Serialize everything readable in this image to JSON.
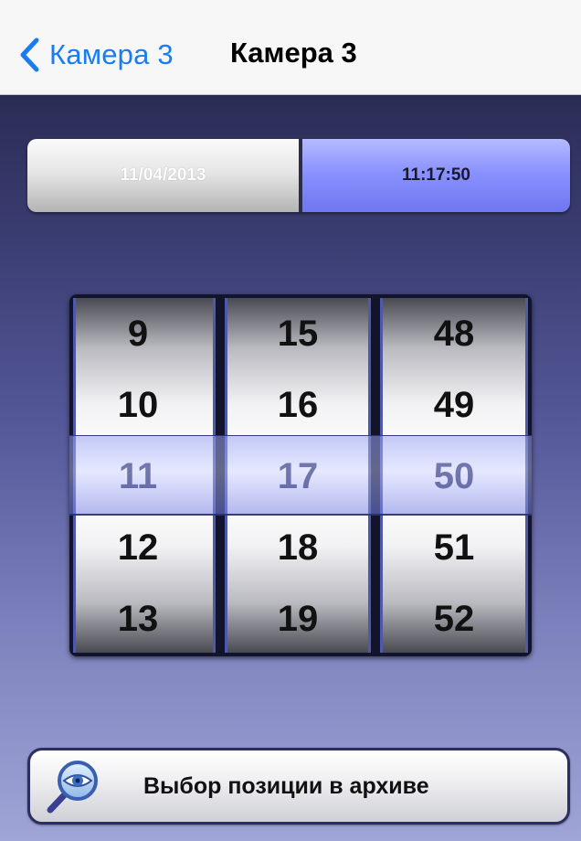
{
  "navbar": {
    "back_label": "Камера 3",
    "title": "Камера 3",
    "back_icon": "chevron-left-icon"
  },
  "segmented": {
    "date_label": "11/04/2013",
    "time_label": "11:17:50",
    "selected": "time"
  },
  "picker": {
    "hours": [
      "9",
      "10",
      "11",
      "12",
      "13"
    ],
    "minutes": [
      "15",
      "16",
      "17",
      "18",
      "19"
    ],
    "seconds": [
      "48",
      "49",
      "50",
      "51",
      "52"
    ],
    "selected": {
      "hour": "11",
      "minute": "17",
      "second": "50"
    }
  },
  "archive_button": {
    "label": "Выбор позиции в архиве",
    "icon": "magnifier-eye-icon"
  },
  "colors": {
    "accent": "#1a7cf0",
    "segment_selected": "#8a92ff",
    "background_top": "#2b2c55",
    "background_bottom": "#9fa5d6"
  }
}
